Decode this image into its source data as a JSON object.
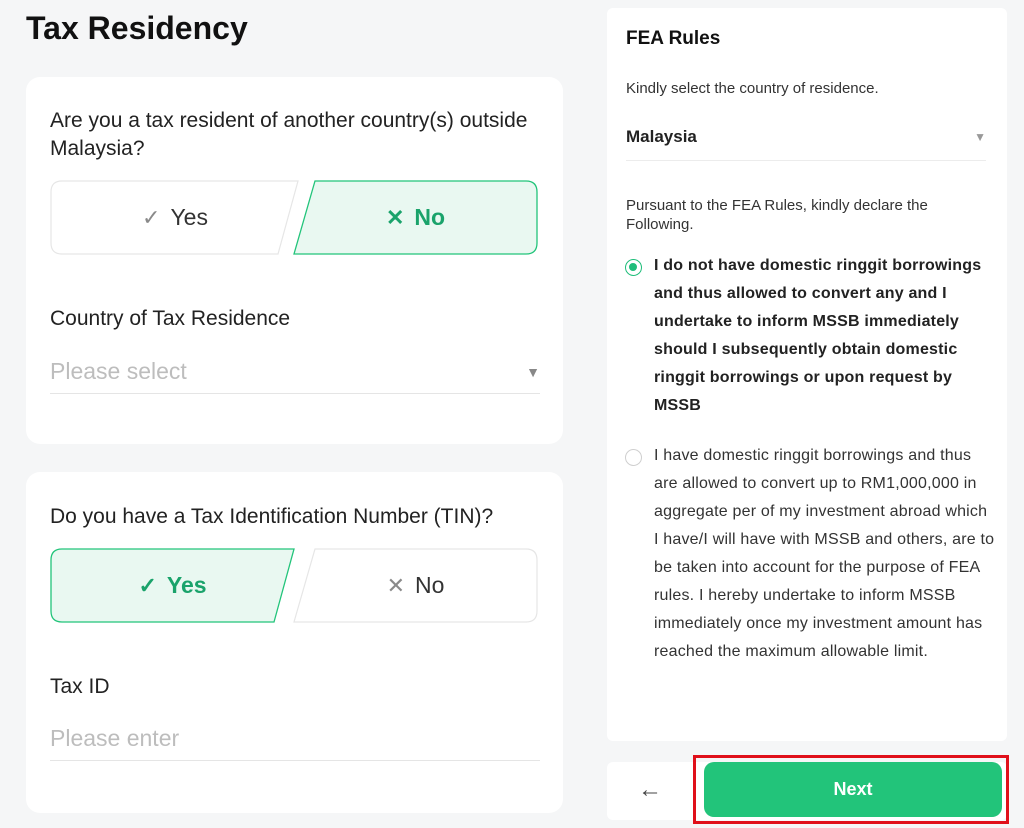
{
  "page": {
    "title": "Tax Residency"
  },
  "residency": {
    "question": "Are you a tax resident of another country(s) outside Malaysia?",
    "options": [
      {
        "label": "Yes",
        "icon": "check-icon",
        "selected": false
      },
      {
        "label": "No",
        "icon": "x-icon",
        "selected": true
      }
    ],
    "country_label": "Country of Tax Residence",
    "country_placeholder": "Please select"
  },
  "tin": {
    "question": "Do you have a Tax Identification Number (TIN)?",
    "options": [
      {
        "label": "Yes",
        "icon": "check-icon",
        "selected": true
      },
      {
        "label": "No",
        "icon": "x-icon",
        "selected": false
      }
    ],
    "taxid_label": "Tax ID",
    "taxid_placeholder": "Please enter"
  },
  "fea": {
    "title": "FEA Rules",
    "country_prompt": "Kindly select the country of residence.",
    "country_value": "Malaysia",
    "declare_prompt": "Pursuant to the FEA Rules, kindly declare the Following.",
    "options": [
      {
        "text": "I do not have domestic ringgit borrowings and thus allowed to convert any and I undertake to inform MSSB immediately should I subsequently obtain domestic ringgit borrowings or upon request by MSSB",
        "selected": true
      },
      {
        "text": "I have domestic ringgit borrowings and thus are allowed to convert up to RM1,000,000 in aggregate per of my investment abroad which I have/I will have with MSSB and others, are to be taken into account for the purpose of FEA rules. I hereby undertake to inform MSSB immediately once my investment amount has reached the maximum allowable limit.",
        "selected": false
      }
    ]
  },
  "footer": {
    "back_icon": "arrow-left-icon",
    "back_glyph": "←",
    "next_label": "Next"
  },
  "colors": {
    "accent": "#22c47a",
    "selected_text": "#1aa36b",
    "highlight": "#e0101a"
  }
}
